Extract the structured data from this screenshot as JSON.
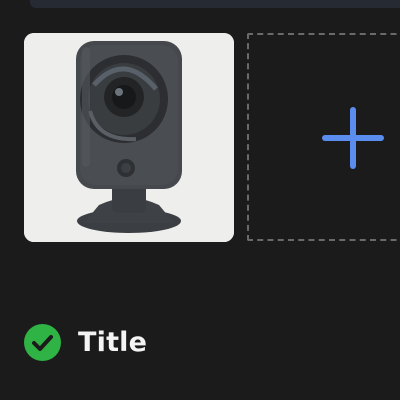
{
  "thumbnail": {
    "icon": "camera-photo",
    "accent": "#eeeeec"
  },
  "add_tile": {
    "icon": "plus-icon",
    "accent": "#5b8def"
  },
  "status": {
    "icon": "check-circle-icon",
    "color": "#2fb344",
    "title": "Title"
  }
}
